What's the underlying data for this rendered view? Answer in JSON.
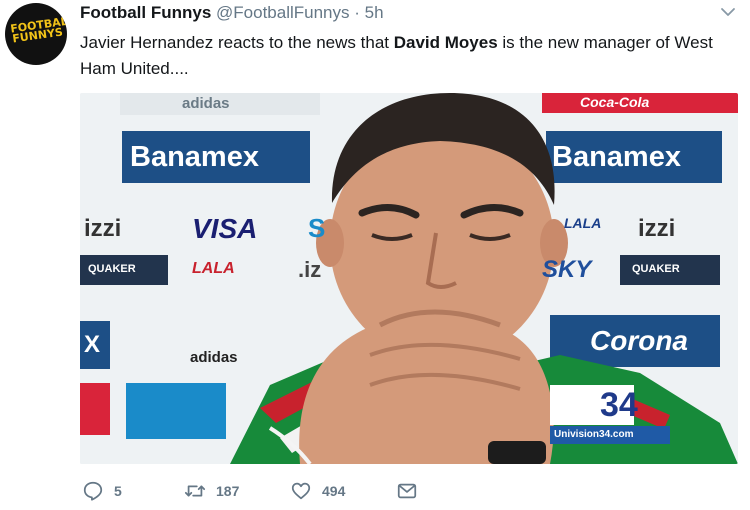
{
  "tweet": {
    "author_name": "Football Funnys",
    "handle": "@FootballFunnys",
    "separator": "·",
    "time": "5h",
    "text_before": "Javier Hernandez reacts to the news that ",
    "text_bold": "David Moyes",
    "text_after": " is the new manager of West Ham United....",
    "avatar_text": "FOOTBALL FUNNYS"
  },
  "media": {
    "sponsors": {
      "adidas_top": "adidas",
      "banamex_left": "Banamex",
      "banamex_right": "Banamex",
      "coca_cola": "Coca-Cola",
      "izzi_left": "izzi",
      "visa": "VISA",
      "s_partial": "S",
      "lala_right": "LALA",
      "izzi_right": "izzi",
      "quaker_left": "QUAKER",
      "lala_left": "LALA",
      "iz_partial": ".iz",
      "sky": "SKY",
      "quaker_right": "QUAKER",
      "x_partial": "X",
      "adidas_bottom": "adidas",
      "corona": "Corona"
    },
    "channel_number": "34",
    "channel_url": "Univision34.com"
  },
  "actions": {
    "replies": "5",
    "retweets": "187",
    "likes": "494"
  }
}
